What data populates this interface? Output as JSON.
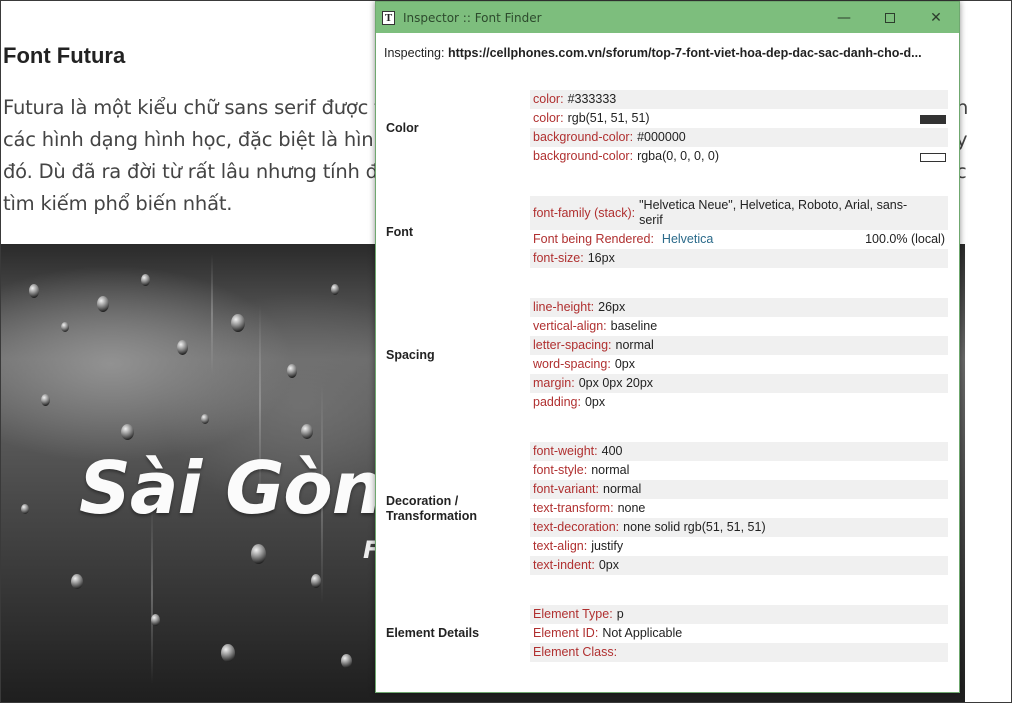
{
  "article": {
    "heading": "Font Futura",
    "lines": [
      "Futura là một kiểu chữ sans serif được thi",
      "các hình dạng hình học, đặc biệt là hình t",
      "đó. Dù đã ra đời từ rất lâu nhưng tính đế",
      "tìm kiếm phổ biến nhất."
    ],
    "right_fragments": [
      "n",
      "y",
      "c"
    ],
    "hero_title": "Sài Gòn",
    "hero_sub": "F"
  },
  "inspector": {
    "title": "Inspector :: Font Finder",
    "icon": "text-T-icon",
    "controls": {
      "minimize": "—",
      "close": "✕"
    },
    "inspecting_label": "Inspecting:",
    "inspecting_url": "https://cellphones.com.vn/sforum/top-7-font-viet-hoa-dep-dac-sac-danh-cho-d...",
    "sections": {
      "color": {
        "label": "Color",
        "rows": [
          {
            "key": "color:",
            "value": "#333333"
          },
          {
            "key": "color:",
            "value": "rgb(51, 51, 51)",
            "swatch": "#333333"
          },
          {
            "key": "background-color:",
            "value": "#000000"
          },
          {
            "key": "background-color:",
            "value": "rgba(0, 0, 0, 0)",
            "swatch": "#ffffff"
          }
        ]
      },
      "font": {
        "label": "Font",
        "family_key": "font-family (stack):",
        "family_value": "\"Helvetica Neue\", Helvetica, Roboto, Arial, sans-serif",
        "rendered_key": "Font being Rendered:",
        "rendered_name": "Helvetica",
        "rendered_pct": "100.0% (local)",
        "size_key": "font-size:",
        "size_value": "16px"
      },
      "spacing": {
        "label": "Spacing",
        "rows": [
          {
            "key": "line-height:",
            "value": "26px"
          },
          {
            "key": "vertical-align:",
            "value": "baseline"
          },
          {
            "key": "letter-spacing:",
            "value": "normal"
          },
          {
            "key": "word-spacing:",
            "value": "0px"
          },
          {
            "key": "margin:",
            "value": "0px 0px 20px"
          },
          {
            "key": "padding:",
            "value": "0px"
          }
        ]
      },
      "decoration": {
        "label_line1": "Decoration /",
        "label_line2": "Transformation",
        "rows": [
          {
            "key": "font-weight:",
            "value": "400"
          },
          {
            "key": "font-style:",
            "value": "normal"
          },
          {
            "key": "font-variant:",
            "value": "normal"
          },
          {
            "key": "text-transform:",
            "value": "none"
          },
          {
            "key": "text-decoration:",
            "value": "none solid rgb(51, 51, 51)"
          },
          {
            "key": "text-align:",
            "value": "justify"
          },
          {
            "key": "text-indent:",
            "value": "0px"
          }
        ]
      },
      "element": {
        "label": "Element Details",
        "rows": [
          {
            "key": "Element Type:",
            "value": "p"
          },
          {
            "key": "Element ID:",
            "value": "Not Applicable"
          },
          {
            "key": "Element Class:",
            "value": ""
          }
        ]
      }
    }
  },
  "colors": {
    "titlebar": "#7dbe7d",
    "key_red": "#b03030",
    "rendered_blue": "#2a6a8a"
  }
}
